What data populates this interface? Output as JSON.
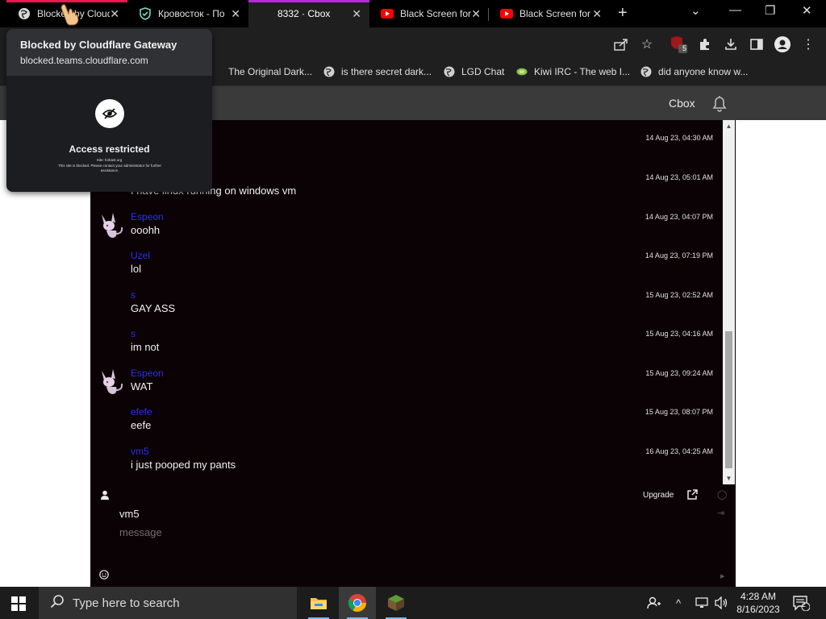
{
  "browser": {
    "tabs": [
      {
        "title": "Blocked by Cloudflare Gateway",
        "accent": "#e8194f",
        "active": false
      },
      {
        "title": "Кровосток - По",
        "accent": "",
        "active": false
      },
      {
        "title": "8332 · Cbox",
        "accent": "#b92ad9",
        "active": true
      },
      {
        "title": "Black Screen for",
        "accent": "",
        "active": false
      },
      {
        "title": "Black Screen for",
        "accent": "",
        "active": false
      }
    ],
    "new_tab_label": "+",
    "bookmarks": [
      {
        "label": "The Original Dark...",
        "icon": "none"
      },
      {
        "label": "is there secret dark...",
        "icon": "globe-icon"
      },
      {
        "label": "LGD Chat",
        "icon": "globe-icon"
      },
      {
        "label": "Kiwi IRC - The web I...",
        "icon": "kiwi-icon"
      },
      {
        "label": "did anyone know w...",
        "icon": "globe-icon"
      }
    ],
    "extension_badge": "5"
  },
  "popup": {
    "title": "Blocked by Cloudflare Gateway",
    "url": "blocked.teams.cloudflare.com",
    "heading": "Access restricted",
    "site": "Site: forkast.org",
    "note": "This site is blocked. Please contact your administrator for further assistance."
  },
  "page": {
    "brand": "Cbox"
  },
  "messages": [
    {
      "name": "",
      "text": "",
      "time": "14 Aug 23, 04:30 AM",
      "avatar": false
    },
    {
      "name": "",
      "text": "I have linux running on windows vm",
      "time": "14 Aug 23, 05:01 AM",
      "avatar": false
    },
    {
      "name": "Espeon",
      "text": "ooohh",
      "time": "14 Aug 23, 04:07 PM",
      "avatar": true
    },
    {
      "name": "Uzel",
      "text": "lol",
      "time": "14 Aug 23, 07:19 PM",
      "avatar": false
    },
    {
      "name": "s",
      "text": "GAY ASS",
      "time": "15 Aug 23, 02:52 AM",
      "avatar": false
    },
    {
      "name": "s",
      "text": "im not",
      "time": "15 Aug 23, 04:16 AM",
      "avatar": false
    },
    {
      "name": "Espeon",
      "text": "WAT",
      "time": "15 Aug 23, 09:24 AM",
      "avatar": true
    },
    {
      "name": "efefe",
      "text": "eefe",
      "time": "15 Aug 23, 08:07 PM",
      "avatar": false
    },
    {
      "name": "vm5",
      "text": "i just pooped my pants",
      "time": "16 Aug 23, 04:25 AM",
      "avatar": false
    }
  ],
  "composer": {
    "upgrade_label": "Upgrade",
    "username": "vm5",
    "placeholder": "message"
  },
  "taskbar": {
    "search_placeholder": "Type here to search",
    "time": "4:28 AM",
    "date": "8/16/2023",
    "notification_count": "2"
  },
  "colors": {
    "chat_bg": "#0b0205",
    "name_color": "#2b2ff0",
    "header_bg": "#3a3a3a"
  }
}
